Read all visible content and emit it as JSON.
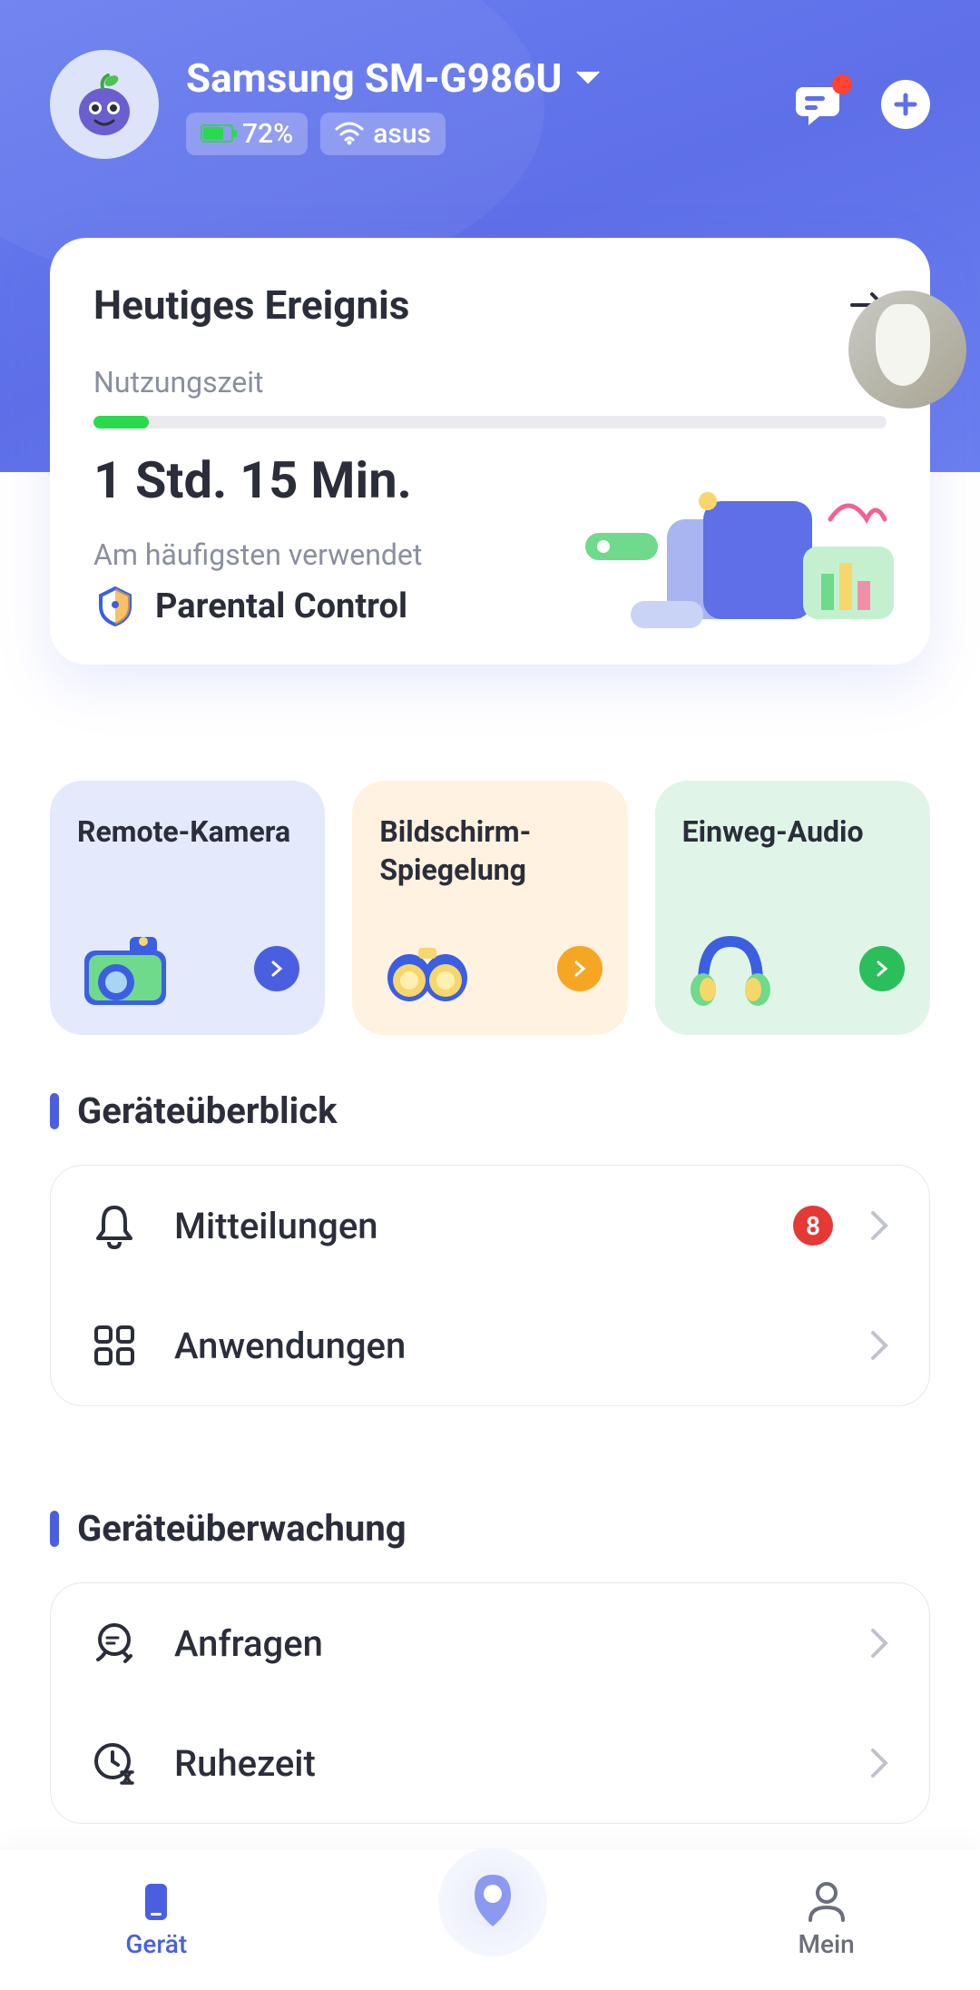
{
  "header": {
    "device_name": "Samsung SM-G986U",
    "battery": "72%",
    "wifi": "asus"
  },
  "event_card": {
    "title": "Heutiges Ereignis",
    "usage_label": "Nutzungszeit",
    "usage_time": "1 Std. 15 Min.",
    "most_used_label": "Am häufigsten verwendet",
    "most_used_app": "Parental Control",
    "progress_percent": 7
  },
  "features": [
    {
      "title": "Remote-Kamera"
    },
    {
      "title": "Bildschirm-Spiegelung"
    },
    {
      "title": "Einweg-Audio"
    }
  ],
  "sections": {
    "overview": {
      "title": "Geräteüberblick",
      "items": [
        {
          "label": "Mitteilungen",
          "badge": "8"
        },
        {
          "label": "Anwendungen",
          "badge": null
        }
      ]
    },
    "monitoring": {
      "title": "Geräteüberwachung",
      "items": [
        {
          "label": "Anfragen"
        },
        {
          "label": "Ruhezeit"
        }
      ]
    }
  },
  "nav": {
    "device": "Gerät",
    "mine": "Mein"
  }
}
